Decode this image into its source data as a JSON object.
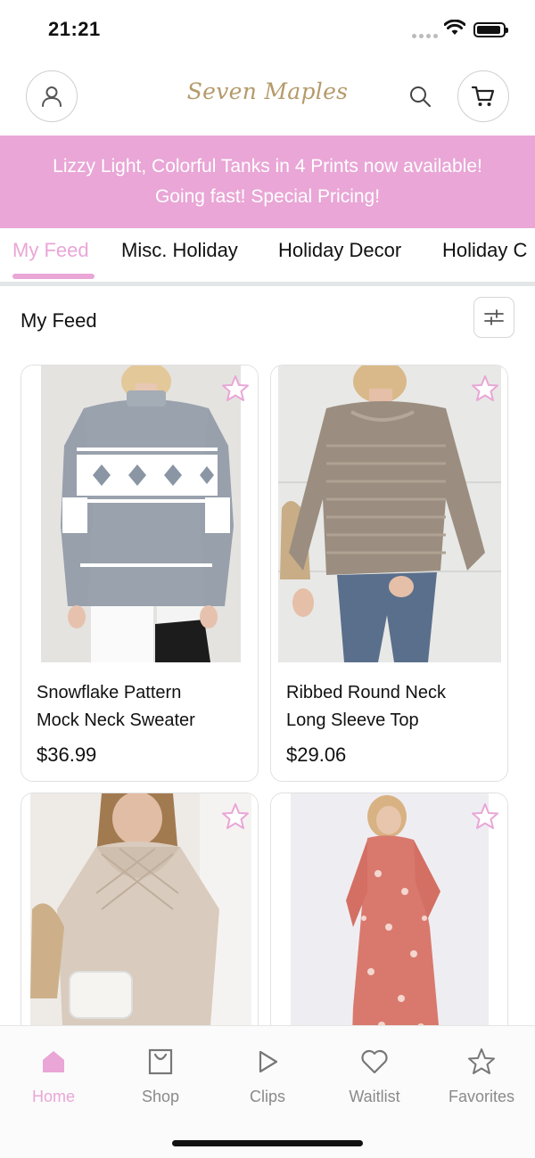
{
  "status_bar": {
    "time": "21:21"
  },
  "header": {
    "logo_text": "Seven Maples",
    "profile_icon": "user-icon",
    "search_icon": "search-icon",
    "cart_icon": "cart-icon"
  },
  "banner": {
    "line1": "Lizzy Light, Colorful Tanks in 4 Prints now available!",
    "line2": "Going fast! Special Pricing!",
    "background": "#e9a6d6",
    "text_color": "#ffffff"
  },
  "tabs": [
    {
      "label": "My Feed",
      "active": true
    },
    {
      "label": "Misc. Holiday",
      "active": false
    },
    {
      "label": "Holiday Decor",
      "active": false
    },
    {
      "label": "Holiday C",
      "active": false
    }
  ],
  "feed": {
    "title": "My Feed",
    "filter_icon": "sliders-icon"
  },
  "products": [
    {
      "name_line1": "Snowflake Pattern",
      "name_line2": "Mock Neck Sweater",
      "price": "$36.99",
      "favorite_icon": "star-icon"
    },
    {
      "name_line1": "Ribbed Round Neck",
      "name_line2": "Long Sleeve Top",
      "price": "$29.06",
      "favorite_icon": "star-icon"
    },
    {
      "name_line1": "",
      "name_line2": "",
      "price": "",
      "favorite_icon": "star-icon"
    },
    {
      "name_line1": "",
      "name_line2": "",
      "price": "",
      "favorite_icon": "star-icon"
    }
  ],
  "bottom_nav": [
    {
      "label": "Home",
      "icon": "home-icon",
      "active": true
    },
    {
      "label": "Shop",
      "icon": "shopping-bag-icon",
      "active": false
    },
    {
      "label": "Clips",
      "icon": "play-icon",
      "active": false
    },
    {
      "label": "Waitlist",
      "icon": "heart-icon",
      "active": false
    },
    {
      "label": "Favorites",
      "icon": "star-icon",
      "active": false
    }
  ],
  "colors": {
    "accent": "#e9a6d6",
    "logo": "#b59a6a",
    "inactive_nav": "#8a8a8a"
  }
}
